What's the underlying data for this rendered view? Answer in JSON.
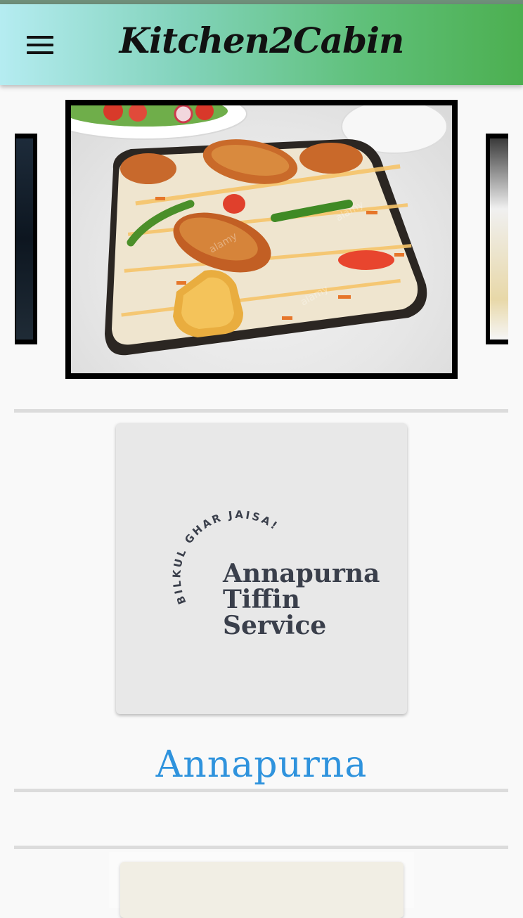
{
  "app_bar": {
    "title": "Kitchen2Cabin",
    "menu_icon": "hamburger-menu-icon",
    "gradient_colors": [
      "#b5ecf1",
      "#4caf50"
    ]
  },
  "carousel": {
    "current_image": "chicken biryani plate",
    "watermark": "alamy"
  },
  "vendors": [
    {
      "logo": {
        "tagline": "BILKUL GHAR JAISA!",
        "line1": "Annapurna",
        "line2": "Tiffin",
        "line3": "Service"
      },
      "name": "Annapurna"
    }
  ],
  "colors": {
    "vendor_name": "#2f93dd",
    "logo_text": "#3a3f4b",
    "logo_card_bg": "#e8e8e8"
  }
}
